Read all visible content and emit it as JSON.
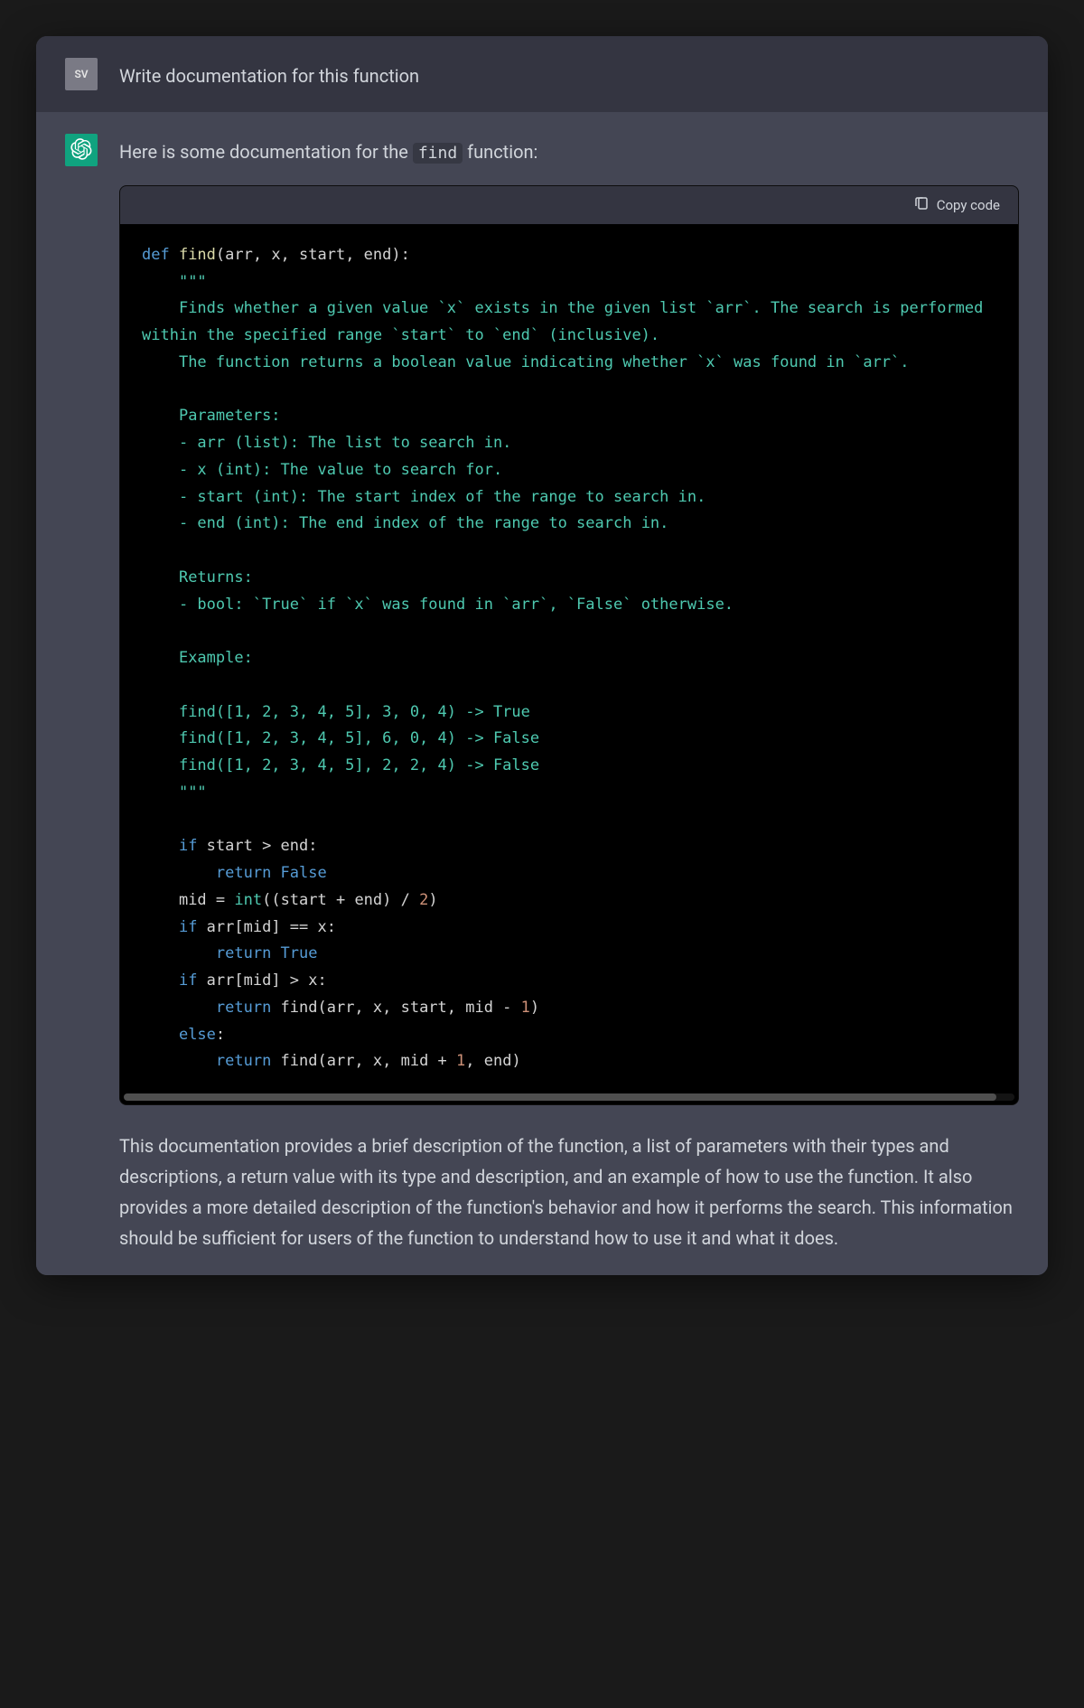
{
  "user": {
    "avatar_text": "SV",
    "message": "Write documentation for this function"
  },
  "assistant": {
    "intro_prefix": "Here is some documentation for the ",
    "intro_code": "find",
    "intro_suffix": " function:",
    "copy_label": "Copy code",
    "code": {
      "l1_def": "def ",
      "l1_func": "find",
      "l1_rest": "(arr, x, start, end):",
      "l2": "    \"\"\"",
      "l3": "    Finds whether a given value `x` exists in the given list `arr`. The search is performed within the specified range `start` to `end` (inclusive).",
      "l4": "    The function returns a boolean value indicating whether `x` was found in `arr`.",
      "blank": "",
      "l5": "    Parameters:",
      "l6": "    - arr (list): The list to search in.",
      "l7": "    - x (int): The value to search for.",
      "l8": "    - start (int): The start index of the range to search in.",
      "l9": "    - end (int): The end index of the range to search in.",
      "l10": "    Returns:",
      "l11": "    - bool: `True` if `x` was found in `arr`, `False` otherwise.",
      "l12": "    Example:",
      "l13": "    find([1, 2, 3, 4, 5], 3, 0, 4) -> True",
      "l14": "    find([1, 2, 3, 4, 5], 6, 0, 4) -> False",
      "l15": "    find([1, 2, 3, 4, 5], 2, 2, 4) -> False",
      "l16": "    \"\"\"",
      "l17_if": "    if ",
      "l17_rest": "start > end:",
      "l18_ret": "        return ",
      "l18_val": "False",
      "l19a": "    mid = ",
      "l19b": "int",
      "l19c": "((start + end) / ",
      "l19d": "2",
      "l19e": ")",
      "l20_if": "    if ",
      "l20_rest": "arr[mid] == x:",
      "l21_ret": "        return ",
      "l21_val": "True",
      "l22_if": "    if ",
      "l22_rest": "arr[mid] > x:",
      "l23_ret": "        return ",
      "l23a": "find(arr, x, start, mid - ",
      "l23b": "1",
      "l23c": ")",
      "l24_else": "    else",
      "l24_colon": ":",
      "l25_ret": "        return ",
      "l25a": "find(arr, x, mid + ",
      "l25b": "1",
      "l25c": ", end)"
    },
    "closing": "This documentation provides a brief description of the function, a list of parameters with their types and descriptions, a return value with its type and description, and an example of how to use the function. It also provides a more detailed description of the function's behavior and how it performs the search. This information should be sufficient for users of the function to understand how to use it and what it does."
  }
}
